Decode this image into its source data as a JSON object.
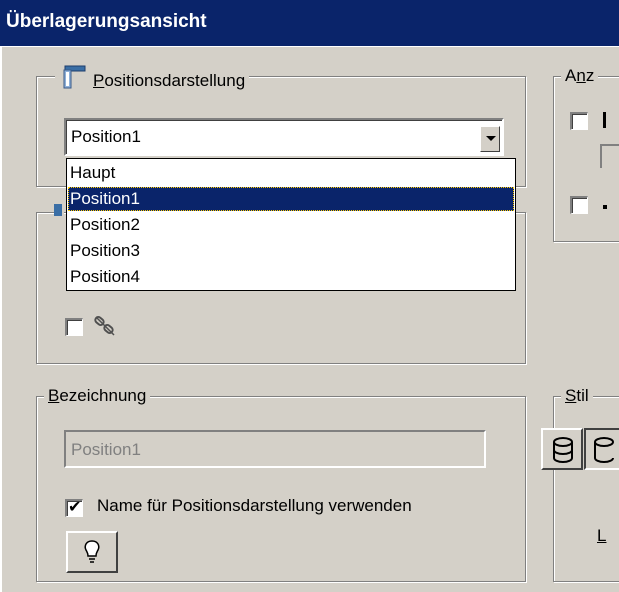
{
  "window": {
    "title": "Überlagerungsansicht"
  },
  "position_group": {
    "legend_prefix": "",
    "legend_underlined": "P",
    "legend_rest": "ositionsdarstellung",
    "combo_value": "Position1",
    "dropdown": {
      "items": [
        "Haupt",
        "Position1",
        "Position2",
        "Position3",
        "Position4"
      ],
      "selected_index": 1
    }
  },
  "anzeige_group": {
    "legend_prefix": "A",
    "legend_underlined": "n",
    "legend_rest": "z"
  },
  "bezeichnung_group": {
    "legend_underlined": "B",
    "legend_rest": "ezeichnung",
    "name_value": "Position1",
    "use_name_checkbox_label": "Name für Positionsdarstellung verwenden",
    "use_name_checked": true
  },
  "stil_group": {
    "legend_underlined": "S",
    "legend_rest": "til",
    "partial_label_underlined": "L"
  },
  "colors": {
    "title_bg": "#0a246a",
    "dialog_bg": "#d4d0c8",
    "selection_bg": "#0a246a"
  },
  "icons": {
    "position_group_icon": "monitor-position-icon",
    "unlink_icon": "unlink-icon",
    "lightbulb_icon": "lightbulb-icon",
    "cylinder_icon": "cylinder-icon"
  }
}
